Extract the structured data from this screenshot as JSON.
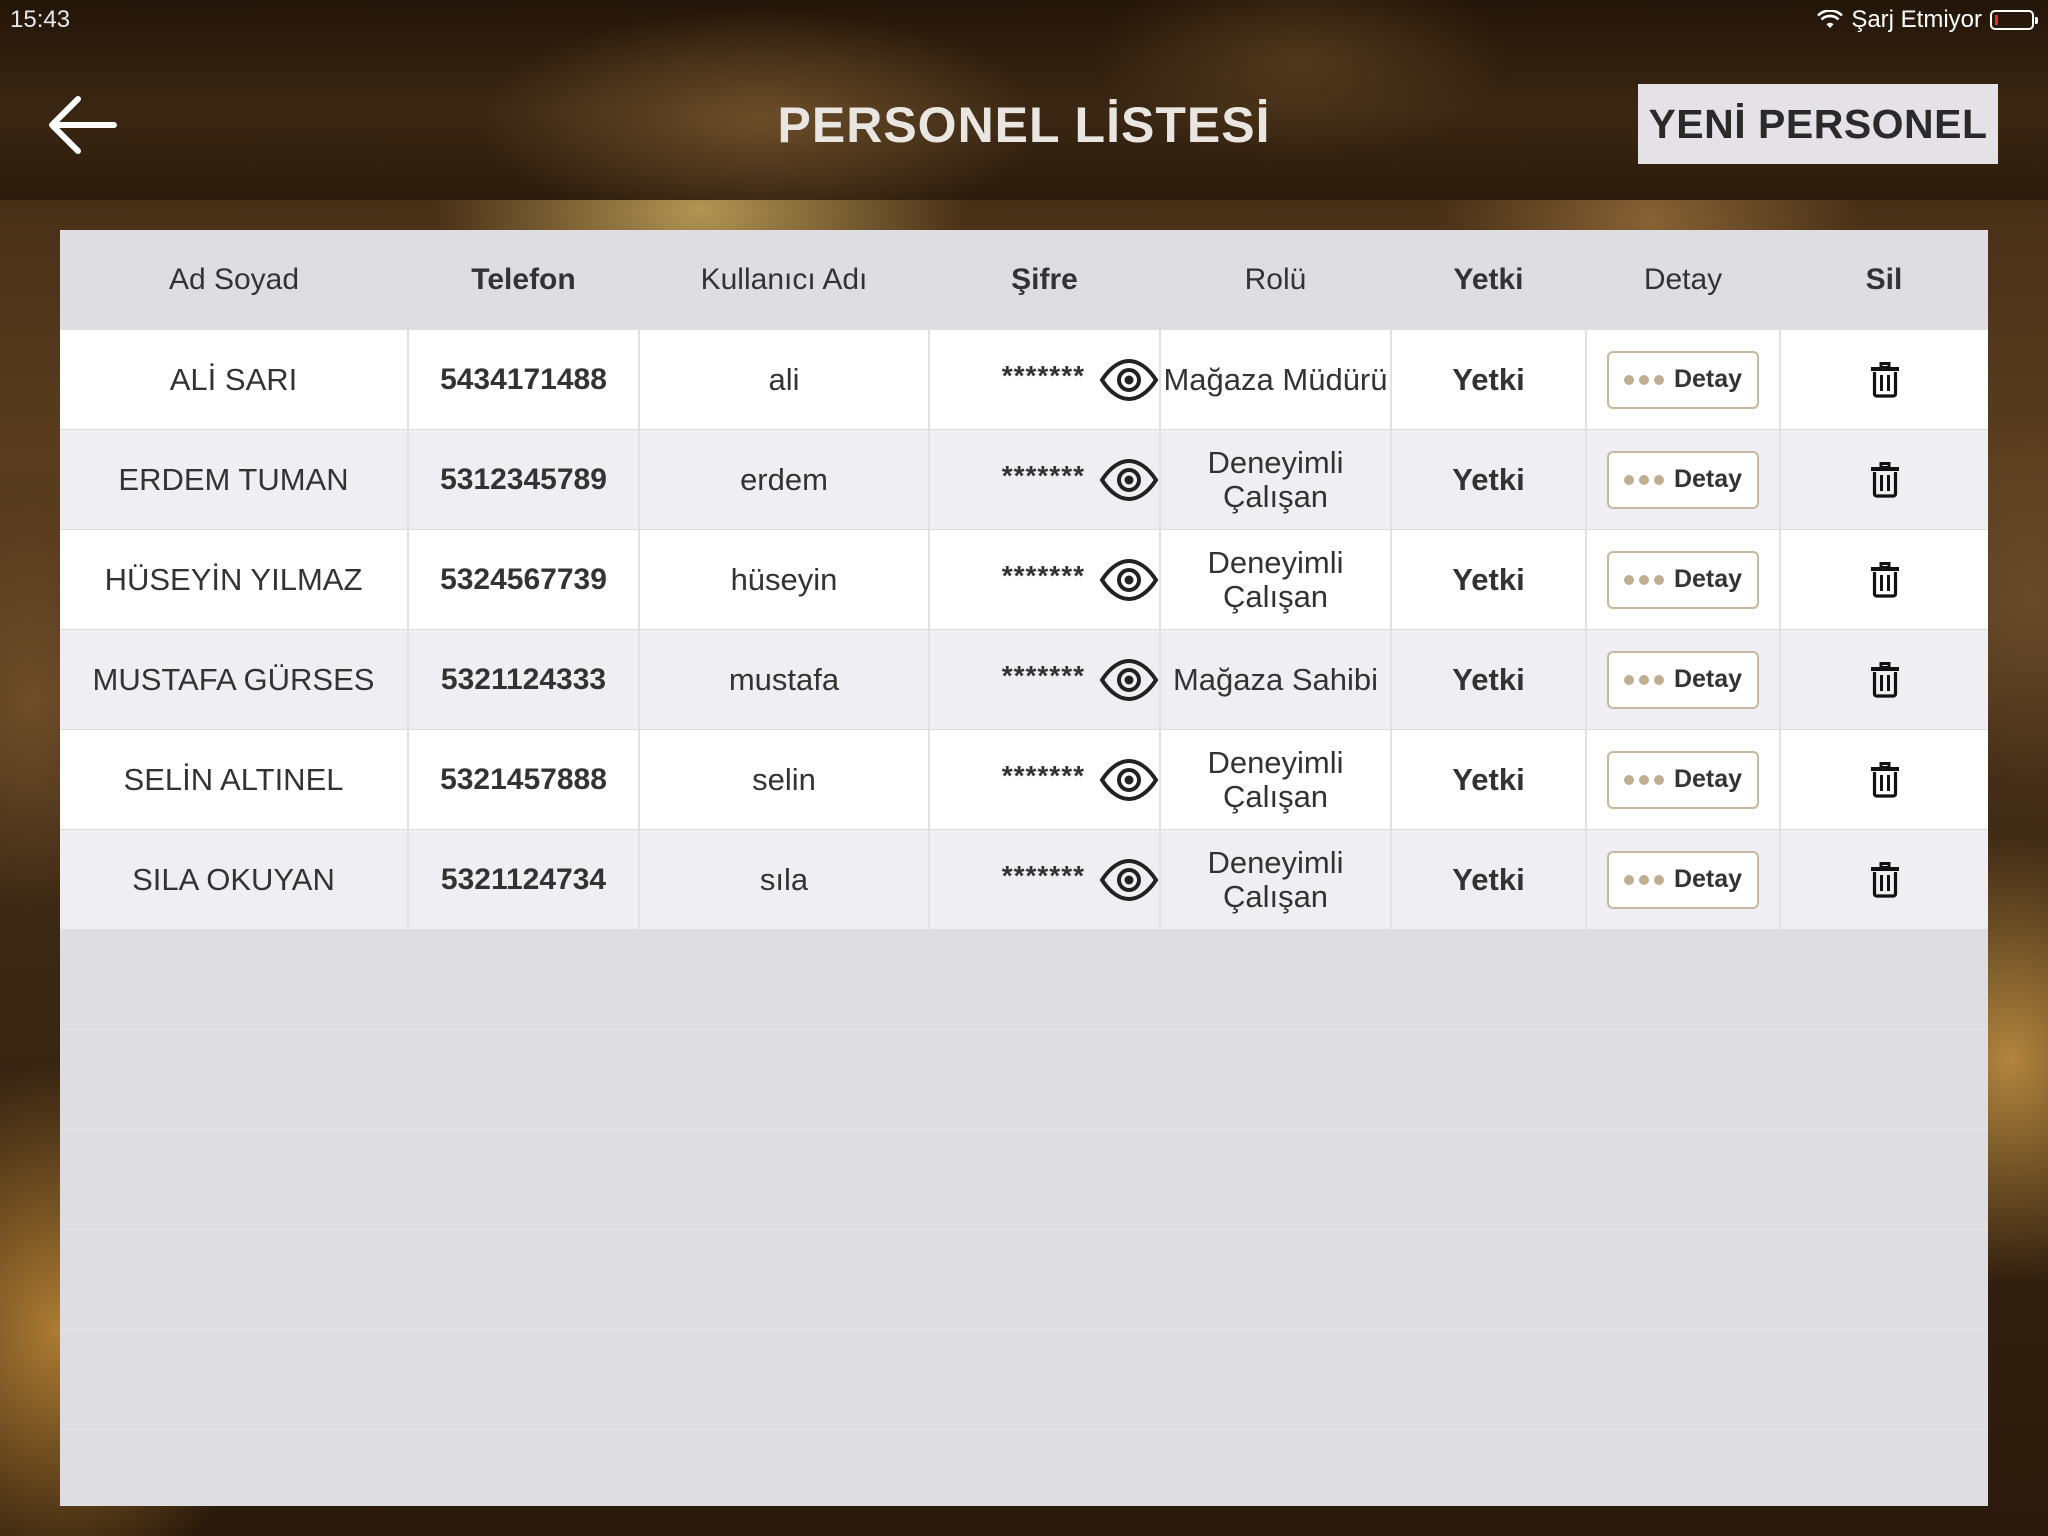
{
  "status_bar": {
    "time": "15:43",
    "charging_text": "Şarj Etmiyor"
  },
  "header": {
    "title": "PERSONEL LİSTESİ",
    "new_button_label": "YENİ PERSONEL"
  },
  "table": {
    "columns": {
      "name": "Ad Soyad",
      "phone": "Telefon",
      "username": "Kullanıcı Adı",
      "password": "Şifre",
      "role": "Rolü",
      "permission": "Yetki",
      "detail": "Detay",
      "delete": "Sil"
    },
    "rows": [
      {
        "name": "ALİ SARI",
        "phone": "5434171488",
        "username": "ali",
        "password_mask": "*******",
        "role_line1": "Mağaza Müdürü",
        "role_line2": "",
        "permission": "Yetki",
        "detail_label": "Detay"
      },
      {
        "name": "ERDEM TUMAN",
        "phone": "5312345789",
        "username": "erdem",
        "password_mask": "*******",
        "role_line1": "Deneyimli",
        "role_line2": "Çalışan",
        "permission": "Yetki",
        "detail_label": "Detay"
      },
      {
        "name": "HÜSEYİN YILMAZ",
        "phone": "5324567739",
        "username": "hüseyin",
        "password_mask": "*******",
        "role_line1": "Deneyimli",
        "role_line2": "Çalışan",
        "permission": "Yetki",
        "detail_label": "Detay"
      },
      {
        "name": "MUSTAFA GÜRSES",
        "phone": "5321124333",
        "username": "mustafa",
        "password_mask": "*******",
        "role_line1": "Mağaza Sahibi",
        "role_line2": "",
        "permission": "Yetki",
        "detail_label": "Detay"
      },
      {
        "name": "SELİN ALTINEL",
        "phone": "5321457888",
        "username": "selin",
        "password_mask": "*******",
        "role_line1": "Deneyimli",
        "role_line2": "Çalışan",
        "permission": "Yetki",
        "detail_label": "Detay"
      },
      {
        "name": "SILA OKUYAN",
        "phone": "5321124734",
        "username": "sıla",
        "password_mask": "*******",
        "role_line1": "Deneyimli",
        "role_line2": "Çalışan",
        "permission": "Yetki",
        "detail_label": "Detay"
      }
    ]
  },
  "icons": {
    "back": "arrow-left-icon",
    "password_toggle": "eye-icon",
    "detail": "dots-icon",
    "delete": "trash-icon",
    "wifi": "wifi-icon",
    "battery": "battery-icon"
  },
  "colors": {
    "header_bg": "#2c1c0d",
    "button_bg": "#e4e2e6",
    "panel_bg": "#dedde2",
    "detail_border": "#c8b79e",
    "battery_low": "#e0302a"
  }
}
